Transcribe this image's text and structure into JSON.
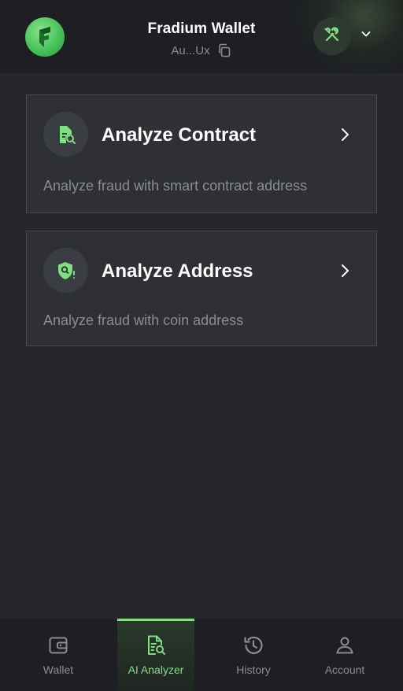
{
  "header": {
    "wallet_name": "Fradium Wallet",
    "address_short": "Au...Ux",
    "logo_icon": "fradium-logo-icon",
    "tools_icon": "tools-icon",
    "menu_icon": "chevron-down-icon"
  },
  "cards": [
    {
      "title": "Analyze Contract",
      "description": "Analyze fraud with smart contract address",
      "icon": "document-search-icon"
    },
    {
      "title": "Analyze Address",
      "description": "Analyze fraud with coin address",
      "icon": "shield-search-icon"
    }
  ],
  "nav": {
    "items": [
      {
        "label": "Wallet",
        "icon": "wallet-icon",
        "active": false
      },
      {
        "label": "AI Analyzer",
        "icon": "document-search-icon",
        "active": true
      },
      {
        "label": "History",
        "icon": "history-icon",
        "active": false
      },
      {
        "label": "Account",
        "icon": "user-icon",
        "active": false
      }
    ]
  },
  "colors": {
    "accent": "#7ee07f",
    "background": "#25272b",
    "header_bg": "#1d1f22",
    "card_bg": "#2e3034",
    "muted_text": "#8a8d92"
  }
}
